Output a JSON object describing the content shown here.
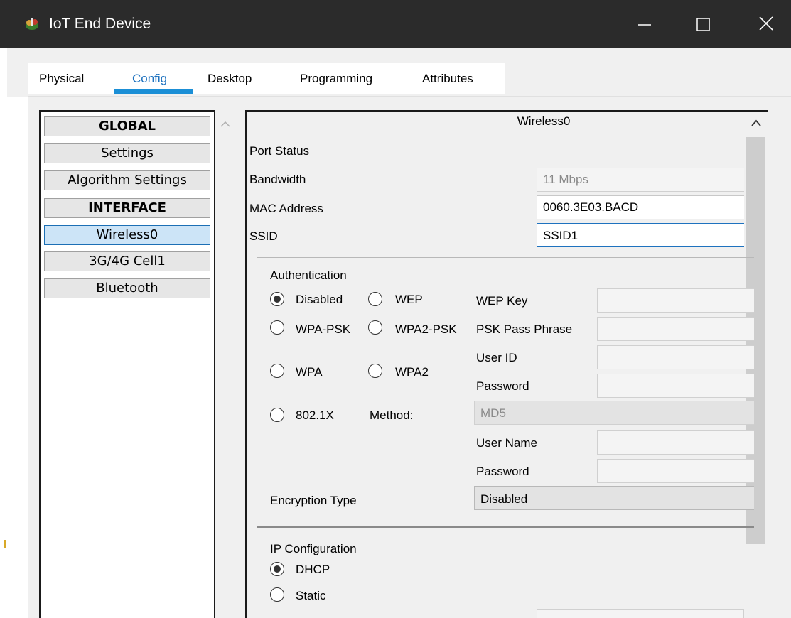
{
  "window": {
    "title": "IoT End Device",
    "icon": "iot-device-icon",
    "controls": [
      "minimize-icon",
      "maximize-icon",
      "close-icon"
    ]
  },
  "tabs": [
    {
      "label": "Physical",
      "active": false
    },
    {
      "label": "Config",
      "active": true
    },
    {
      "label": "Desktop",
      "active": false
    },
    {
      "label": "Programming",
      "active": false
    },
    {
      "label": "Attributes",
      "active": false
    }
  ],
  "nav": {
    "items": [
      {
        "label": "GLOBAL",
        "header": true
      },
      {
        "label": "Settings",
        "header": false
      },
      {
        "label": "Algorithm Settings",
        "header": false
      },
      {
        "label": "INTERFACE",
        "header": true
      },
      {
        "label": "Wireless0",
        "header": false,
        "selected": true
      },
      {
        "label": "3G/4G Cell1",
        "header": false
      },
      {
        "label": "Bluetooth",
        "header": false
      }
    ]
  },
  "interface": {
    "title": "Wireless0",
    "port_status_label": "Port Status",
    "bandwidth_label": "Bandwidth",
    "bandwidth_value": "11 Mbps",
    "mac_label": "MAC Address",
    "mac_value": "0060.3E03.BACD",
    "ssid_label": "SSID",
    "ssid_value": "SSID1"
  },
  "authentication": {
    "title": "Authentication",
    "options": {
      "disabled": "Disabled",
      "wep": "WEP",
      "wpa_psk": "WPA-PSK",
      "wpa2_psk": "WPA2-PSK",
      "wpa": "WPA",
      "wpa2": "WPA2",
      "dot1x": "802.1X"
    },
    "selected": "disabled",
    "wep_key_label": "WEP Key",
    "psk_label": "PSK Pass Phrase",
    "user_id_label": "User ID",
    "password_label": "Password",
    "method_label": "Method:",
    "method_value": "MD5",
    "user_name_label": "User Name",
    "password2_label": "Password",
    "encryption_label": "Encryption Type",
    "encryption_value": "Disabled"
  },
  "ip_config": {
    "title": "IP Configuration",
    "dhcp_label": "DHCP",
    "static_label": "Static",
    "selected": "dhcp"
  },
  "colors": {
    "titlebar": "#2b2b2b",
    "accent_tab": "#1b8fd6",
    "selected_item": "#cce4f7"
  }
}
